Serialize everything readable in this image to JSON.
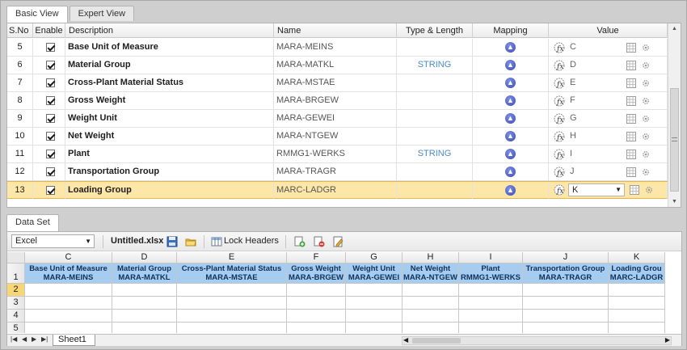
{
  "top_tabs": [
    "Basic View",
    "Expert View"
  ],
  "grid": {
    "headers": [
      "S.No",
      "Enable",
      "Description",
      "Name",
      "Type & Length",
      "Mapping",
      "Value"
    ],
    "rows": [
      {
        "sno": "5",
        "description": "Base Unit of Measure",
        "name": "MARA-MEINS",
        "type": "",
        "value": "C",
        "selected": false
      },
      {
        "sno": "6",
        "description": "Material Group",
        "name": "MARA-MATKL",
        "type": "STRING",
        "value": "D",
        "selected": false
      },
      {
        "sno": "7",
        "description": "Cross-Plant Material Status",
        "name": "MARA-MSTAE",
        "type": "",
        "value": "E",
        "selected": false
      },
      {
        "sno": "8",
        "description": "Gross Weight",
        "name": "MARA-BRGEW",
        "type": "",
        "value": "F",
        "selected": false
      },
      {
        "sno": "9",
        "description": "Weight Unit",
        "name": "MARA-GEWEI",
        "type": "",
        "value": "G",
        "selected": false
      },
      {
        "sno": "10",
        "description": "Net Weight",
        "name": "MARA-NTGEW",
        "type": "",
        "value": "H",
        "selected": false
      },
      {
        "sno": "11",
        "description": "Plant",
        "name": "RMMG1-WERKS",
        "type": "STRING",
        "value": "I",
        "selected": false
      },
      {
        "sno": "12",
        "description": "Transportation Group",
        "name": "MARA-TRAGR",
        "type": "",
        "value": "J",
        "selected": false
      },
      {
        "sno": "13",
        "description": "Loading Group",
        "name": "MARC-LADGR",
        "type": "",
        "value": "K",
        "selected": true
      }
    ]
  },
  "dataset": {
    "tab": "Data Set",
    "format": "Excel",
    "filename": "Untitled.xlsx",
    "lock_headers": "Lock Headers",
    "sheet_name": "Sheet1",
    "columns": [
      {
        "letter": "C",
        "label": "Base Unit of Measure",
        "field": "MARA-MEINS"
      },
      {
        "letter": "D",
        "label": "Material Group",
        "field": "MARA-MATKL"
      },
      {
        "letter": "E",
        "label": "Cross-Plant Material Status",
        "field": "MARA-MSTAE"
      },
      {
        "letter": "F",
        "label": "Gross Weight",
        "field": "MARA-BRGEW"
      },
      {
        "letter": "G",
        "label": "Weight Unit",
        "field": "MARA-GEWEI"
      },
      {
        "letter": "H",
        "label": "Net Weight",
        "field": "MARA-NTGEW"
      },
      {
        "letter": "I",
        "label": "Plant",
        "field": "RMMG1-WERKS"
      },
      {
        "letter": "J",
        "label": "Transportation Group",
        "field": "MARA-TRAGR"
      },
      {
        "letter": "K",
        "label": "Loading Grou",
        "field": "MARC-LADGR"
      }
    ],
    "row_numbers": [
      "1",
      "2",
      "3",
      "4",
      "5"
    ]
  }
}
